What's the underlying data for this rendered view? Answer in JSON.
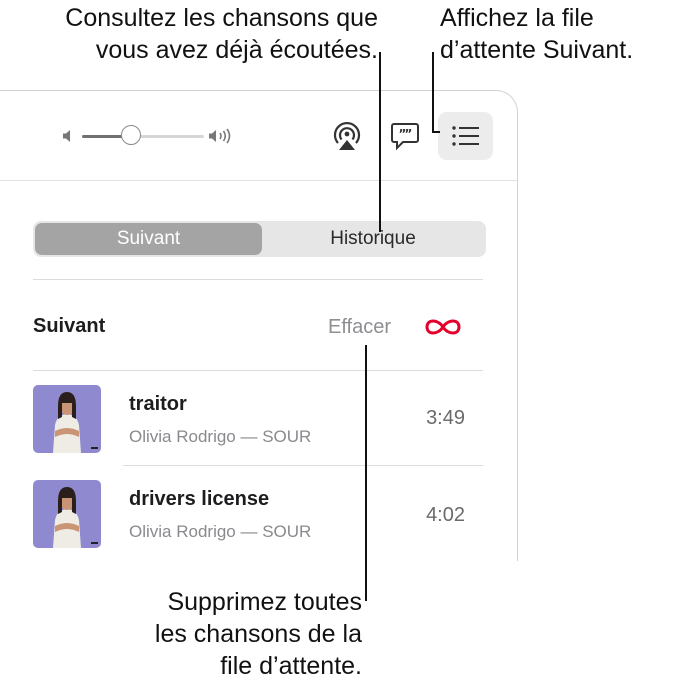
{
  "callouts": {
    "history": {
      "line1": "Consultez les chansons que",
      "line2": "vous avez déjà écoutées."
    },
    "queue": {
      "line1": "Affichez la file",
      "line2": "d’attente Suivant."
    },
    "clear": {
      "line1": "Supprimez toutes",
      "line2": "les chansons de la",
      "line3": "file d’attente."
    }
  },
  "toolbar": {
    "volume": 0.4,
    "icons": [
      "volume-low-icon",
      "volume-high-icon",
      "airplay-icon",
      "lyrics-icon",
      "queue-list-icon"
    ]
  },
  "tabs": {
    "active": "Suivant",
    "inactive": "Historique"
  },
  "queue": {
    "title": "Suivant",
    "clear_label": "Effacer",
    "autoplay_icon": "infinity-icon",
    "tracks": [
      {
        "title": "traitor",
        "subtitle": "Olivia Rodrigo — SOUR",
        "duration": "3:49"
      },
      {
        "title": "drivers license",
        "subtitle": "Olivia Rodrigo — SOUR",
        "duration": "4:02"
      }
    ]
  },
  "colors": {
    "accent": "#e3002b",
    "tab_active": "#a4a4a4",
    "artwork_bg": "#8f89cf"
  }
}
